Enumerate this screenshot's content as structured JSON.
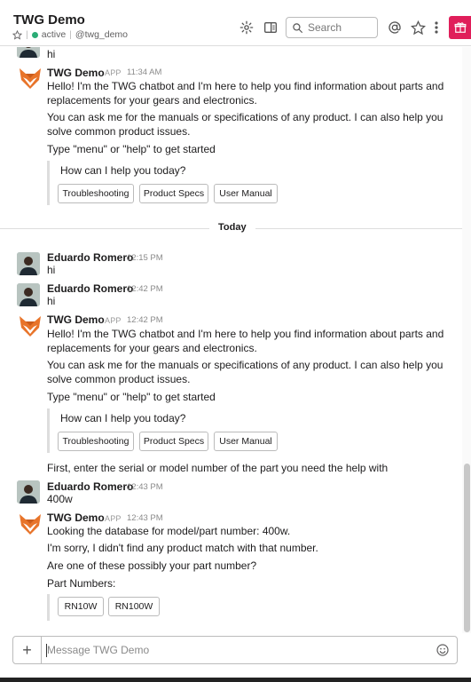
{
  "header": {
    "channel_title": "TWG Demo",
    "status_text": "active",
    "handle": "@twg_demo",
    "search_placeholder": "Search"
  },
  "messages": {
    "top_partial_text": "hi",
    "bot_name": "TWG Demo",
    "app_tag": "APP",
    "user_name": "Eduardo Romero",
    "msg1": {
      "time": "11:34 AM",
      "line1": "Hello! I'm the TWG chatbot and I'm here to help you find information about parts and replacements for your gears and electronics.",
      "line2": "You can ask me for the manuals or specifications of any product. I can also help you solve common product issues.",
      "line3": "Type \"menu\" or \"help\" to get started",
      "quote": "How can I help you today?",
      "buttons": [
        "Troubleshooting",
        "Product Specs",
        "User Manual"
      ]
    },
    "divider_label": "Today",
    "msg2": {
      "time": "12:15 PM",
      "text": "hi"
    },
    "msg3": {
      "time": "12:42 PM",
      "text": "hi"
    },
    "msg4": {
      "time": "12:42 PM",
      "line1": "Hello! I'm the TWG chatbot and I'm here to help you find information about parts and replacements for your gears and electronics.",
      "line2": "You can ask me for the manuals or specifications of any product. I can also help you solve common product issues.",
      "line3": "Type \"menu\" or \"help\" to get started",
      "quote": "How can I help you today?",
      "buttons": [
        "Troubleshooting",
        "Product Specs",
        "User Manual"
      ],
      "line4": "First, enter the serial or model number of the part you need the help with"
    },
    "msg5": {
      "time": "12:43 PM",
      "text": "400w"
    },
    "msg6": {
      "time": "12:43 PM",
      "line1": "Looking the database for model/part number: 400w.",
      "line2": "I'm sorry, I didn't find any product match with that number.",
      "line3": "Are one of these possibly your part number?",
      "line4": "Part Numbers:",
      "buttons": [
        "RN10W",
        "RN100W"
      ]
    }
  },
  "composer": {
    "placeholder": "Message TWG Demo"
  },
  "colors": {
    "accent_green": "#2bac76",
    "gift_red": "#e01e5a",
    "bot_orange": "#e8742a"
  }
}
